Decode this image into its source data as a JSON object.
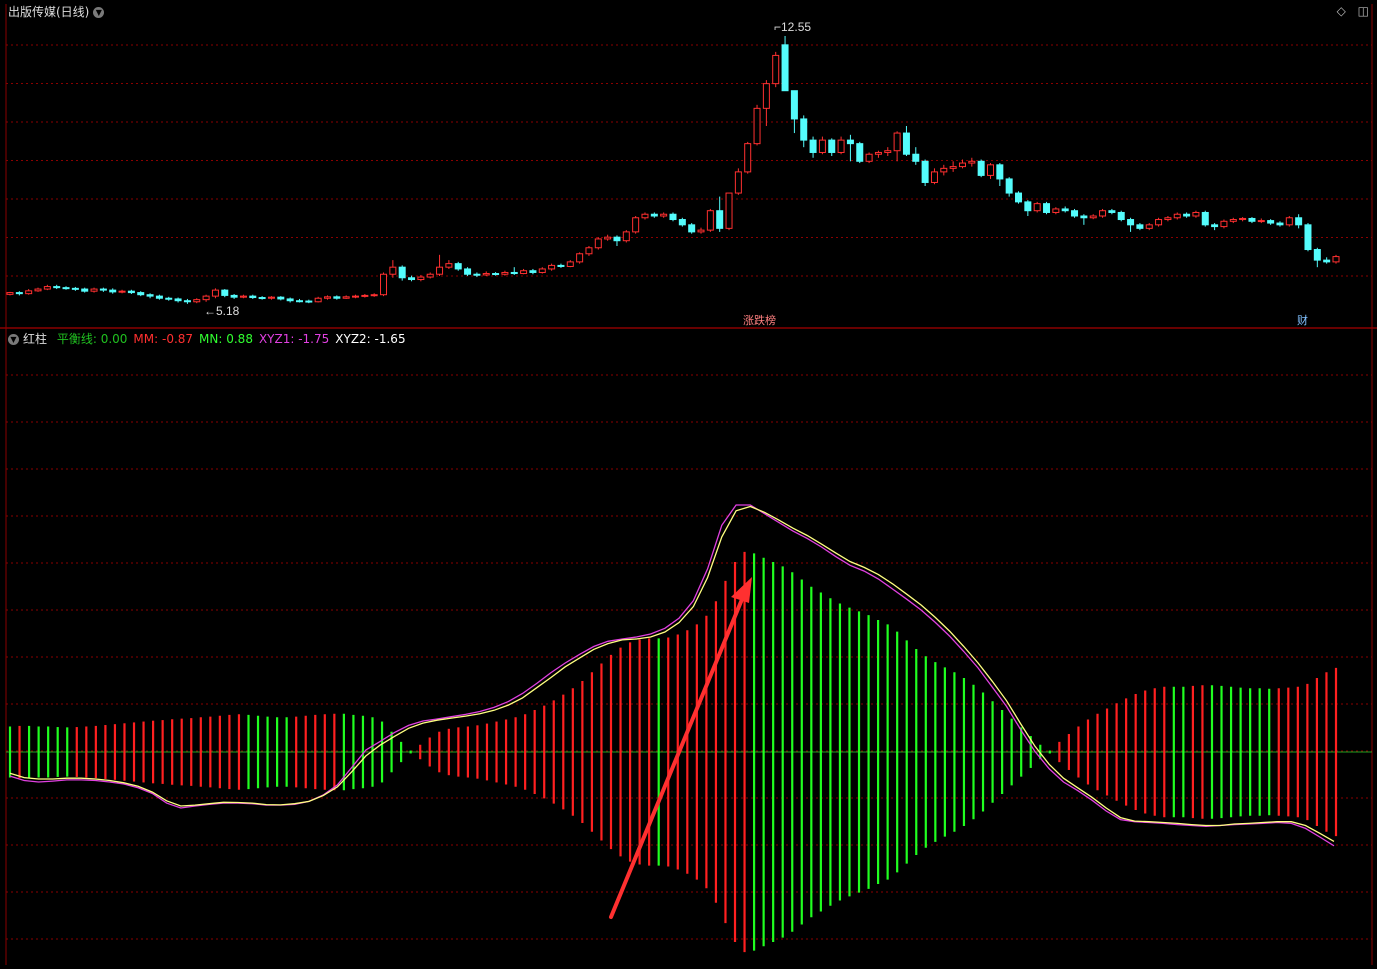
{
  "header": {
    "title": "出版传媒(日线)",
    "menu_icon": "chevron-down-icon"
  },
  "window_controls": {
    "diamond": "◇",
    "restore": "◫"
  },
  "indicator": {
    "name": "红柱",
    "entries": [
      {
        "label": "平衡线:",
        "value": "0.00",
        "color": "#20c020"
      },
      {
        "label": "MM:",
        "value": "-0.87",
        "color": "#ff3030"
      },
      {
        "label": "MN:",
        "value": "0.88",
        "color": "#30ff30"
      },
      {
        "label": "XYZ1:",
        "value": "-1.75",
        "color": "#e040e0"
      },
      {
        "label": "XYZ2:",
        "value": "-1.65",
        "color": "#ffffff"
      }
    ]
  },
  "chart_data": {
    "type": "candlestick",
    "annotations": {
      "high": "12.55",
      "low": "5.18",
      "event1": "涨跌榜",
      "event2": "财"
    },
    "colors": {
      "up": "#ff3030",
      "down": "#54fcfc",
      "grid": "#8a0000",
      "bar_red": "#ff2020",
      "bar_green": "#20ff20",
      "xyz1": "#e040e0",
      "xyz2": "#ffff80"
    },
    "candles": [
      [
        5.23,
        5.28,
        5.3,
        5.2
      ],
      [
        5.28,
        5.25,
        5.32,
        5.2
      ],
      [
        5.25,
        5.33,
        5.38,
        5.22
      ],
      [
        5.33,
        5.38,
        5.42,
        5.3
      ],
      [
        5.38,
        5.45,
        5.5,
        5.35
      ],
      [
        5.45,
        5.42,
        5.5,
        5.38
      ],
      [
        5.42,
        5.4,
        5.46,
        5.36
      ],
      [
        5.4,
        5.38,
        5.44,
        5.33
      ],
      [
        5.38,
        5.32,
        5.42,
        5.28
      ],
      [
        5.32,
        5.38,
        5.42,
        5.28
      ],
      [
        5.38,
        5.35,
        5.42,
        5.3
      ],
      [
        5.35,
        5.3,
        5.4,
        5.25
      ],
      [
        5.3,
        5.32,
        5.36,
        5.26
      ],
      [
        5.32,
        5.28,
        5.36,
        5.24
      ],
      [
        5.28,
        5.22,
        5.32,
        5.18
      ],
      [
        5.22,
        5.18,
        5.26,
        5.12
      ],
      [
        5.18,
        5.12,
        5.22,
        5.08
      ],
      [
        5.12,
        5.1,
        5.16,
        5.05
      ],
      [
        5.1,
        5.05,
        5.14,
        5.0
      ],
      [
        5.05,
        5.02,
        5.1,
        4.96
      ],
      [
        5.02,
        5.08,
        5.12,
        4.98
      ],
      [
        5.08,
        5.18,
        5.22,
        5.02
      ],
      [
        5.18,
        5.35,
        5.4,
        5.12
      ],
      [
        5.35,
        5.2,
        5.38,
        5.15
      ],
      [
        5.2,
        5.15,
        5.24,
        5.1
      ],
      [
        5.15,
        5.18,
        5.22,
        5.12
      ],
      [
        5.18,
        5.14,
        5.22,
        5.1
      ],
      [
        5.14,
        5.12,
        5.18,
        5.08
      ],
      [
        5.12,
        5.15,
        5.18,
        5.08
      ],
      [
        5.15,
        5.1,
        5.18,
        5.06
      ],
      [
        5.1,
        5.05,
        5.14,
        5.0
      ],
      [
        5.05,
        5.04,
        5.1,
        5.0
      ],
      [
        5.04,
        5.02,
        5.08,
        4.98
      ],
      [
        5.02,
        5.12,
        5.16,
        5.0
      ],
      [
        5.12,
        5.16,
        5.2,
        5.08
      ],
      [
        5.16,
        5.12,
        5.2,
        5.08
      ],
      [
        5.12,
        5.16,
        5.2,
        5.1
      ],
      [
        5.16,
        5.18,
        5.22,
        5.12
      ],
      [
        5.18,
        5.2,
        5.24,
        5.14
      ],
      [
        5.2,
        5.22,
        5.26,
        5.16
      ],
      [
        5.22,
        5.8,
        5.85,
        5.18
      ],
      [
        5.8,
        6.0,
        6.2,
        5.7
      ],
      [
        6.0,
        5.7,
        6.05,
        5.62
      ],
      [
        5.7,
        5.65,
        5.76,
        5.6
      ],
      [
        5.65,
        5.72,
        5.78,
        5.6
      ],
      [
        5.72,
        5.8,
        5.85,
        5.68
      ],
      [
        5.8,
        6.0,
        6.35,
        5.75
      ],
      [
        6.0,
        6.1,
        6.2,
        5.95
      ],
      [
        6.1,
        5.95,
        6.15,
        5.9
      ],
      [
        5.95,
        5.8,
        6.0,
        5.75
      ],
      [
        5.8,
        5.78,
        5.85,
        5.72
      ],
      [
        5.78,
        5.82,
        5.88,
        5.75
      ],
      [
        5.82,
        5.8,
        5.86,
        5.76
      ],
      [
        5.8,
        5.85,
        5.9,
        5.76
      ],
      [
        5.85,
        5.82,
        6.0,
        5.78
      ],
      [
        5.82,
        5.9,
        5.95,
        5.8
      ],
      [
        5.9,
        5.85,
        5.95,
        5.8
      ],
      [
        5.85,
        5.95,
        6.0,
        5.82
      ],
      [
        5.95,
        6.05,
        6.1,
        5.9
      ],
      [
        6.05,
        6.02,
        6.1,
        5.98
      ],
      [
        6.02,
        6.15,
        6.2,
        6.0
      ],
      [
        6.15,
        6.38,
        6.42,
        6.1
      ],
      [
        6.38,
        6.55,
        6.6,
        6.32
      ],
      [
        6.55,
        6.8,
        6.85,
        6.5
      ],
      [
        6.8,
        6.85,
        6.92,
        6.75
      ],
      [
        6.85,
        6.75,
        6.9,
        6.6
      ],
      [
        6.75,
        7.0,
        7.05,
        6.7
      ],
      [
        7.0,
        7.4,
        7.45,
        6.95
      ],
      [
        7.4,
        7.5,
        7.55,
        7.35
      ],
      [
        7.5,
        7.45,
        7.55,
        7.4
      ],
      [
        7.45,
        7.5,
        7.55,
        7.4
      ],
      [
        7.5,
        7.35,
        7.55,
        7.3
      ],
      [
        7.35,
        7.2,
        7.4,
        7.15
      ],
      [
        7.2,
        7.0,
        7.25,
        6.95
      ],
      [
        7.0,
        7.05,
        7.12,
        6.95
      ],
      [
        7.05,
        7.6,
        7.65,
        7.0
      ],
      [
        7.6,
        7.1,
        8.0,
        7.0
      ],
      [
        7.1,
        8.1,
        8.1,
        7.05
      ],
      [
        8.1,
        8.7,
        8.8,
        8.05
      ],
      [
        8.7,
        9.5,
        9.55,
        8.65
      ],
      [
        9.5,
        10.5,
        10.6,
        9.45
      ],
      [
        10.5,
        11.2,
        11.3,
        10.0
      ],
      [
        11.2,
        12.0,
        12.1,
        11.1
      ],
      [
        12.3,
        11.0,
        12.55,
        11.0
      ],
      [
        11.0,
        10.2,
        10.8,
        9.8
      ],
      [
        10.2,
        9.6,
        10.3,
        9.4
      ],
      [
        9.6,
        9.25,
        9.7,
        9.1
      ],
      [
        9.25,
        9.6,
        9.7,
        9.2
      ],
      [
        9.6,
        9.25,
        9.65,
        9.15
      ],
      [
        9.25,
        9.6,
        9.7,
        9.2
      ],
      [
        9.6,
        9.5,
        9.75,
        9.0
      ],
      [
        9.5,
        9.0,
        9.55,
        8.95
      ],
      [
        9.0,
        9.2,
        9.25,
        8.95
      ],
      [
        9.2,
        9.25,
        9.3,
        9.1
      ],
      [
        9.25,
        9.3,
        9.4,
        9.15
      ],
      [
        9.3,
        9.8,
        9.85,
        9.0
      ],
      [
        9.8,
        9.2,
        10.0,
        9.15
      ],
      [
        9.2,
        9.0,
        9.4,
        8.9
      ],
      [
        9.0,
        8.4,
        9.05,
        8.3
      ],
      [
        8.4,
        8.7,
        8.8,
        8.35
      ],
      [
        8.7,
        8.8,
        8.9,
        8.6
      ],
      [
        8.8,
        8.85,
        9.0,
        8.7
      ],
      [
        8.85,
        8.95,
        9.05,
        8.8
      ],
      [
        8.95,
        9.0,
        9.1,
        8.85
      ],
      [
        9.0,
        8.6,
        9.05,
        8.55
      ],
      [
        8.6,
        8.9,
        8.95,
        8.5
      ],
      [
        8.9,
        8.5,
        8.95,
        8.3
      ],
      [
        8.5,
        8.1,
        8.55,
        8.0
      ],
      [
        8.1,
        7.85,
        8.15,
        7.8
      ],
      [
        7.85,
        7.6,
        7.9,
        7.45
      ],
      [
        7.6,
        7.8,
        7.85,
        7.55
      ],
      [
        7.8,
        7.55,
        7.85,
        7.5
      ],
      [
        7.55,
        7.65,
        7.7,
        7.5
      ],
      [
        7.65,
        7.6,
        7.72,
        7.55
      ],
      [
        7.6,
        7.45,
        7.65,
        7.4
      ],
      [
        7.45,
        7.4,
        7.5,
        7.2
      ],
      [
        7.4,
        7.45,
        7.5,
        7.36
      ],
      [
        7.45,
        7.6,
        7.65,
        7.4
      ],
      [
        7.6,
        7.55,
        7.65,
        7.5
      ],
      [
        7.55,
        7.35,
        7.6,
        7.3
      ],
      [
        7.35,
        7.2,
        7.4,
        7.0
      ],
      [
        7.2,
        7.1,
        7.25,
        7.05
      ],
      [
        7.1,
        7.2,
        7.25,
        7.05
      ],
      [
        7.2,
        7.35,
        7.4,
        7.15
      ],
      [
        7.35,
        7.4,
        7.45,
        7.3
      ],
      [
        7.4,
        7.5,
        7.55,
        7.35
      ],
      [
        7.5,
        7.45,
        7.55,
        7.4
      ],
      [
        7.45,
        7.55,
        7.6,
        7.4
      ],
      [
        7.55,
        7.2,
        7.6,
        7.15
      ],
      [
        7.2,
        7.15,
        7.25,
        7.05
      ],
      [
        7.15,
        7.3,
        7.35,
        7.1
      ],
      [
        7.3,
        7.35,
        7.4,
        7.25
      ],
      [
        7.35,
        7.38,
        7.42,
        7.3
      ],
      [
        7.38,
        7.3,
        7.42,
        7.25
      ],
      [
        7.3,
        7.32,
        7.38,
        7.25
      ],
      [
        7.32,
        7.25,
        7.36,
        7.2
      ],
      [
        7.25,
        7.2,
        7.3,
        7.15
      ],
      [
        7.2,
        7.4,
        7.45,
        7.15
      ],
      [
        7.4,
        7.2,
        7.5,
        7.1
      ],
      [
        7.2,
        6.5,
        7.25,
        6.45
      ],
      [
        6.5,
        6.2,
        6.55,
        6.0
      ],
      [
        6.2,
        6.15,
        6.28,
        6.1
      ],
      [
        6.15,
        6.3,
        6.35,
        6.1
      ]
    ],
    "histogram_mn": [
      0.88,
      0.9,
      0.9,
      0.88,
      0.88,
      0.86,
      0.85,
      0.86,
      0.88,
      0.9,
      0.93,
      0.96,
      0.99,
      1.02,
      1.05,
      1.08,
      1.1,
      1.13,
      1.15,
      1.17,
      1.2,
      1.22,
      1.25,
      1.28,
      1.3,
      1.28,
      1.25,
      1.22,
      1.2,
      1.2,
      1.22,
      1.25,
      1.28,
      1.3,
      1.32,
      1.32,
      1.28,
      1.25,
      1.2,
      1.05,
      0.7,
      0.35,
      0.05,
      -0.25,
      -0.5,
      -0.7,
      -0.8,
      -0.85,
      -0.88,
      -0.92,
      -0.98,
      -1.05,
      -1.12,
      -1.2,
      -1.3,
      -1.45,
      -1.6,
      -1.78,
      -1.98,
      -2.2,
      -2.45,
      -2.75,
      -3.05,
      -3.35,
      -3.6,
      -3.78,
      -3.88,
      -3.92,
      -3.92,
      -3.95,
      -4.05,
      -4.2,
      -4.4,
      -4.7,
      -5.2,
      -5.9,
      -6.55,
      -6.9,
      -6.85,
      -6.7,
      -6.55,
      -6.4,
      -6.2,
      -5.95,
      -5.7,
      -5.5,
      -5.3,
      -5.12,
      -4.98,
      -4.85,
      -4.72,
      -4.55,
      -4.4,
      -4.15,
      -3.85,
      -3.55,
      -3.3,
      -3.1,
      -2.92,
      -2.75,
      -2.55,
      -2.32,
      -2.05,
      -1.75,
      -1.45,
      -1.15,
      -0.85,
      -0.55,
      -0.25,
      0.05,
      0.35,
      0.62,
      0.88,
      1.12,
      1.32,
      1.5,
      1.68,
      1.85,
      2.0,
      2.12,
      2.2,
      2.25,
      2.25,
      2.25,
      2.28,
      2.3,
      2.3,
      2.28,
      2.25,
      2.22,
      2.2,
      2.2,
      2.18,
      2.2,
      2.22,
      2.25,
      2.35,
      2.55,
      2.75,
      2.9
    ],
    "xyz1": [
      -0.85,
      -1.0,
      -1.05,
      -1.02,
      -0.98,
      -0.98,
      -1.0,
      -1.05,
      -1.12,
      -1.25,
      -1.45,
      -1.78,
      -1.95,
      -1.88,
      -1.82,
      -1.78,
      -1.78,
      -1.8,
      -1.85,
      -1.85,
      -1.82,
      -1.72,
      -1.5,
      -1.15,
      -0.55,
      0.05,
      0.35,
      0.65,
      0.9,
      1.05,
      1.12,
      1.2,
      1.28,
      1.38,
      1.52,
      1.72,
      2.0,
      2.35,
      2.72,
      3.05,
      3.35,
      3.62,
      3.8,
      3.88,
      3.95,
      4.05,
      4.25,
      4.6,
      5.2,
      6.3,
      7.8,
      8.5,
      8.5,
      8.2,
      7.9,
      7.6,
      7.35,
      7.05,
      6.72,
      6.42,
      6.22,
      5.95,
      5.6,
      5.25,
      4.88,
      4.45,
      3.98,
      3.45,
      2.88,
      2.22,
      1.55,
      0.75,
      0.0,
      -0.6,
      -1.05,
      -1.35,
      -1.68,
      -2.05,
      -2.35,
      -2.42,
      -2.45,
      -2.48,
      -2.52,
      -2.55,
      -2.58,
      -2.55,
      -2.52,
      -2.5,
      -2.48,
      -2.45,
      -2.48,
      -2.65,
      -2.95,
      -3.25
    ],
    "xyz2": [
      -0.75,
      -0.9,
      -0.95,
      -0.95,
      -0.92,
      -0.92,
      -0.95,
      -1.0,
      -1.08,
      -1.2,
      -1.4,
      -1.7,
      -1.88,
      -1.85,
      -1.8,
      -1.75,
      -1.76,
      -1.78,
      -1.83,
      -1.84,
      -1.8,
      -1.72,
      -1.52,
      -1.22,
      -0.7,
      -0.15,
      0.22,
      0.52,
      0.8,
      0.98,
      1.08,
      1.15,
      1.22,
      1.3,
      1.42,
      1.6,
      1.85,
      2.2,
      2.55,
      2.92,
      3.22,
      3.52,
      3.72,
      3.85,
      3.88,
      3.95,
      4.12,
      4.45,
      5.0,
      6.0,
      7.4,
      8.3,
      8.45,
      8.25,
      7.98,
      7.7,
      7.45,
      7.15,
      6.85,
      6.55,
      6.35,
      6.1,
      5.78,
      5.42,
      5.05,
      4.62,
      4.15,
      3.62,
      3.05,
      2.42,
      1.75,
      0.95,
      0.18,
      -0.45,
      -0.92,
      -1.25,
      -1.58,
      -1.95,
      -2.28,
      -2.4,
      -2.42,
      -2.45,
      -2.48,
      -2.52,
      -2.55,
      -2.55,
      -2.5,
      -2.48,
      -2.45,
      -2.42,
      -2.42,
      -2.55,
      -2.82,
      -3.1
    ]
  }
}
